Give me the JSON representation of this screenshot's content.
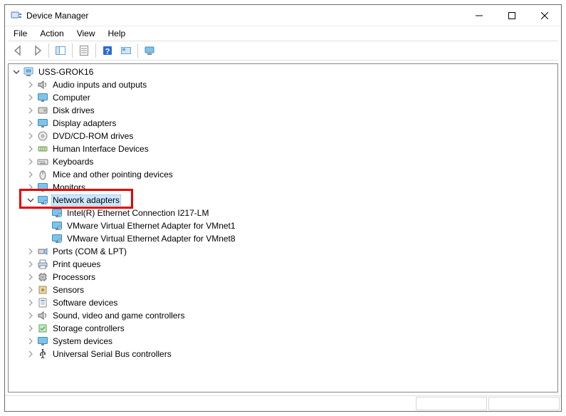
{
  "window": {
    "title": "Device Manager"
  },
  "menu": {
    "file": "File",
    "action": "Action",
    "view": "View",
    "help": "Help"
  },
  "tree": {
    "root": "USS-GROK16",
    "items": [
      {
        "label": "Audio inputs and outputs",
        "icon": "speaker",
        "expanded": false
      },
      {
        "label": "Computer",
        "icon": "monitor",
        "expanded": false
      },
      {
        "label": "Disk drives",
        "icon": "disk",
        "expanded": false
      },
      {
        "label": "Display adapters",
        "icon": "monitor",
        "expanded": false
      },
      {
        "label": "DVD/CD-ROM drives",
        "icon": "disc",
        "expanded": false
      },
      {
        "label": "Human Interface Devices",
        "icon": "hid",
        "expanded": false
      },
      {
        "label": "Keyboards",
        "icon": "keyboard",
        "expanded": false
      },
      {
        "label": "Mice and other pointing devices",
        "icon": "mouse",
        "expanded": false
      },
      {
        "label": "Monitors",
        "icon": "monitor",
        "expanded": false
      },
      {
        "label": "Network adapters",
        "icon": "network",
        "expanded": true,
        "selected": true,
        "highlighted": true,
        "children": [
          {
            "label": "Intel(R) Ethernet Connection I217-LM",
            "icon": "network"
          },
          {
            "label": "VMware Virtual Ethernet Adapter for VMnet1",
            "icon": "network"
          },
          {
            "label": "VMware Virtual Ethernet Adapter for VMnet8",
            "icon": "network"
          }
        ]
      },
      {
        "label": "Ports (COM & LPT)",
        "icon": "port",
        "expanded": false
      },
      {
        "label": "Print queues",
        "icon": "printer",
        "expanded": false
      },
      {
        "label": "Processors",
        "icon": "cpu",
        "expanded": false
      },
      {
        "label": "Sensors",
        "icon": "sensor",
        "expanded": false
      },
      {
        "label": "Software devices",
        "icon": "software",
        "expanded": false
      },
      {
        "label": "Sound, video and game controllers",
        "icon": "speaker",
        "expanded": false
      },
      {
        "label": "Storage controllers",
        "icon": "storage",
        "expanded": false
      },
      {
        "label": "System devices",
        "icon": "monitor",
        "expanded": false
      },
      {
        "label": "Universal Serial Bus controllers",
        "icon": "usb",
        "expanded": false
      }
    ]
  }
}
